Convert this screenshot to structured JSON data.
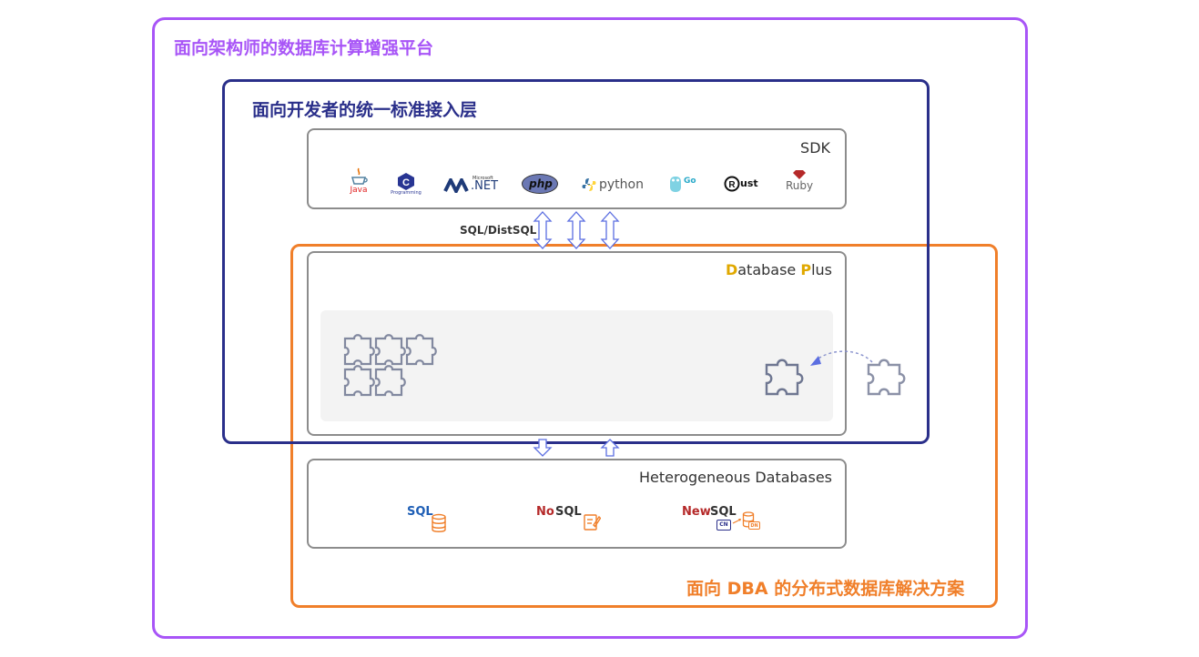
{
  "titles": {
    "outer": "面向架构师的数据库计算增强平台",
    "developer": "面向开发者的统一标准接入层",
    "dba": "面向 DBA 的分布式数据库解决方案"
  },
  "boxes": {
    "sdk": "SDK",
    "database_plus": "Database Plus",
    "heterogeneous": "Heterogeneous Databases"
  },
  "connector_label": "SQL/DistSQL",
  "languages": {
    "java": "Java",
    "c_sub": "Programming",
    "net_small": "Microsoft",
    "net": ".NET",
    "php": "php",
    "python": "python",
    "go": "Go",
    "rust": "ust",
    "ruby": "Ruby"
  },
  "databases": {
    "sql": "SQL",
    "nosql_no": "No",
    "nosql_sql": "SQL",
    "newsql_new": "New",
    "newsql_sql": "SQL",
    "cn": "CN",
    "dn": "DN"
  },
  "colors": {
    "purple": "#a855f7",
    "navy": "#2a2f8a",
    "orange": "#f07f2a",
    "arrow": "#5b6ee1",
    "puzzle": "#6e7691"
  }
}
